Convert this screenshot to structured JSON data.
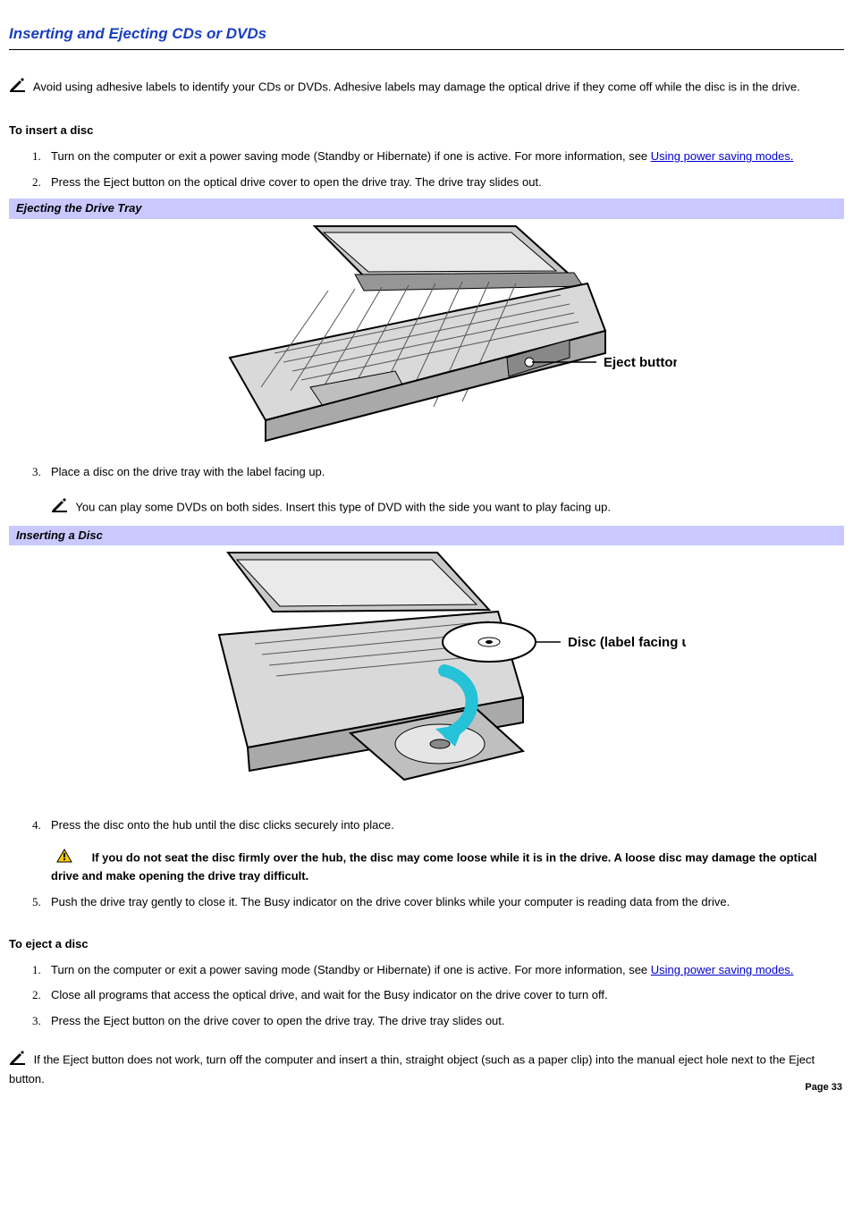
{
  "page_title": "Inserting and Ejecting CDs or DVDs",
  "intro_note": "Avoid using adhesive labels to identify your CDs or DVDs. Adhesive labels may damage the optical drive if they come off while the disc is in the drive.",
  "insert_heading": "To insert a disc",
  "insert_steps": {
    "s1a": "Turn on the computer or exit a power saving mode (Standby or Hibernate) if one is active. For more information, see ",
    "s1_link": "Using power saving modes.",
    "s2": "Press the Eject button on the optical drive cover to open the drive tray. The drive tray slides out.",
    "s3": "Place a disc on the drive tray with the label facing up.",
    "s3_note": "You can play some DVDs on both sides. Insert this type of DVD with the side you want to play facing up.",
    "s4": "Press the disc onto the hub until the disc clicks securely into place.",
    "s4_caution": "If you do not seat the disc firmly over the hub, the disc may come loose while it is in the drive. A loose disc may damage the optical drive and make opening the drive tray difficult.",
    "s5": "Push the drive tray gently to close it. The Busy indicator on the drive cover blinks while your computer is reading data from the drive."
  },
  "fig1_caption": "Ejecting the Drive Tray",
  "fig1_label": "Eject button",
  "fig2_caption": "Inserting a Disc",
  "fig2_label": "Disc (label facing up)",
  "eject_heading": "To eject a disc",
  "eject_steps": {
    "e1a": "Turn on the computer or exit a power saving mode (Standby or Hibernate) if one is active. For more information, see ",
    "e1_link": "Using power saving modes.",
    "e2": "Close all programs that access the optical drive, and wait for the Busy indicator on the drive cover to turn off.",
    "e3": "Press the Eject button on the drive cover to open the drive tray. The drive tray slides out."
  },
  "eject_note": "If the Eject button does not work, turn off the computer and insert a thin, straight object (such as a paper clip) into the manual eject hole next to the Eject button.",
  "page_number": "Page 33"
}
